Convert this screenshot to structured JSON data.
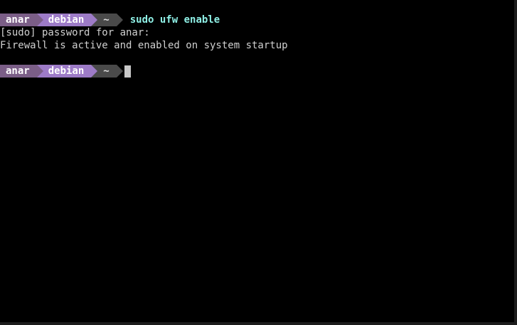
{
  "terminal": {
    "prompt": {
      "user": "anar",
      "host": "debian",
      "dir": "~"
    },
    "command": "sudo ufw enable",
    "output": [
      "[sudo] password for anar:",
      "Firewall is active and enabled on system startup"
    ]
  },
  "colors": {
    "background": "#000000",
    "user_segment": "#7b5e87",
    "host_segment": "#9d7bc7",
    "dir_segment": "#4a4a4a",
    "command_text": "#8ff0e6",
    "output_text": "#d0d0d0",
    "cursor": "#c8c8c8"
  }
}
